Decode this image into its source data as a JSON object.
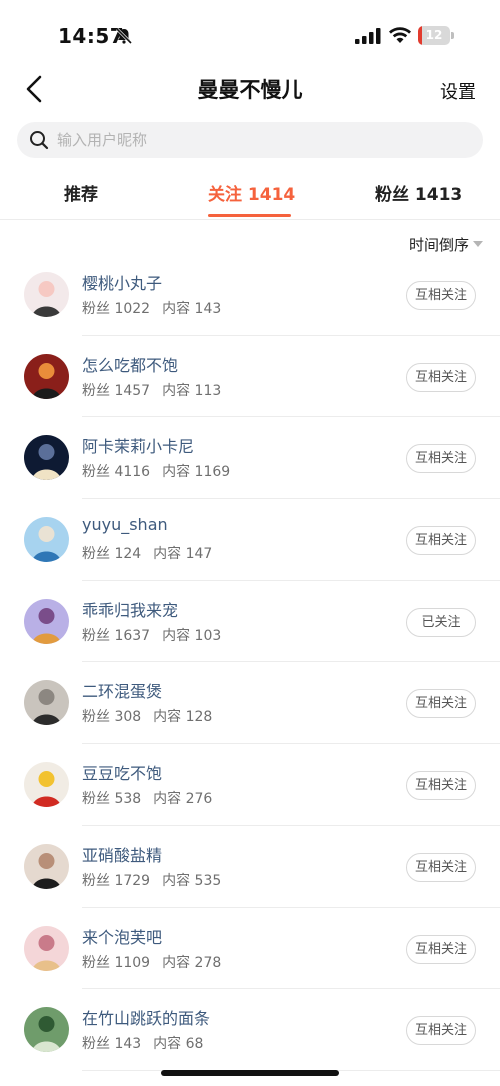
{
  "status_bar": {
    "time": "14:57",
    "battery_level": "12",
    "battery_fraction": 0.12,
    "battery_color": "#e23b2e"
  },
  "nav": {
    "title": "曼曼不慢儿",
    "settings_label": "设置",
    "back_icon": "chevron-left-icon"
  },
  "search": {
    "placeholder": "输入用户昵称",
    "value": "",
    "icon": "search-icon"
  },
  "tabs": [
    {
      "label": "推荐",
      "active": false
    },
    {
      "label": "关注 1414",
      "active": true
    },
    {
      "label": "粉丝 1413",
      "active": false
    }
  ],
  "accent_color": "#f5623d",
  "sort": {
    "label": "时间倒序"
  },
  "users": [
    {
      "name": "樱桃小丸子",
      "fans": "粉丝 1022",
      "content": "内容 143",
      "button": "互相关注",
      "avatar_colors": [
        "#f3e9ea",
        "#3a3a3a",
        "#f6c9c3"
      ]
    },
    {
      "name": "怎么吃都不饱",
      "fans": "粉丝 1457",
      "content": "内容 113",
      "button": "互相关注",
      "avatar_colors": [
        "#8a1f1a",
        "#1b1b1b",
        "#e98d3a"
      ]
    },
    {
      "name": "阿卡茉莉小卡尼",
      "fans": "粉丝 4116",
      "content": "内容 1169",
      "button": "互相关注",
      "avatar_colors": [
        "#0e1a33",
        "#f0e3c5",
        "#5b6f99"
      ]
    },
    {
      "name": "yuyu_shan",
      "fans": "粉丝 124",
      "content": "内容 147",
      "button": "互相关注",
      "avatar_colors": [
        "#a7d3ef",
        "#2f77b6",
        "#e9e2d4"
      ]
    },
    {
      "name": "乖乖归我来宠",
      "fans": "粉丝 1637",
      "content": "内容 103",
      "button": "已关注",
      "avatar_colors": [
        "#b9b0e6",
        "#e29b3f",
        "#7a4d8a"
      ]
    },
    {
      "name": "二环混蛋煲",
      "fans": "粉丝 308",
      "content": "内容 128",
      "button": "互相关注",
      "avatar_colors": [
        "#c9c4bd",
        "#2c2c2c",
        "#8c8781"
      ]
    },
    {
      "name": "豆豆吃不饱",
      "fans": "粉丝 538",
      "content": "内容 276",
      "button": "互相关注",
      "avatar_colors": [
        "#f1ece4",
        "#d12b22",
        "#f2c230"
      ]
    },
    {
      "name": "亚硝酸盐精",
      "fans": "粉丝 1729",
      "content": "内容 535",
      "button": "互相关注",
      "avatar_colors": [
        "#e5d9cf",
        "#1d1d1d",
        "#b88f78"
      ]
    },
    {
      "name": "来个泡芙吧",
      "fans": "粉丝 1109",
      "content": "内容 278",
      "button": "互相关注",
      "avatar_colors": [
        "#f4d6d8",
        "#e8c08a",
        "#c97b8a"
      ]
    },
    {
      "name": "在竹山跳跃的面条",
      "fans": "粉丝 143",
      "content": "内容 68",
      "button": "互相关注",
      "avatar_colors": [
        "#6f9c6b",
        "#d9e6d0",
        "#2f5a33"
      ]
    }
  ]
}
